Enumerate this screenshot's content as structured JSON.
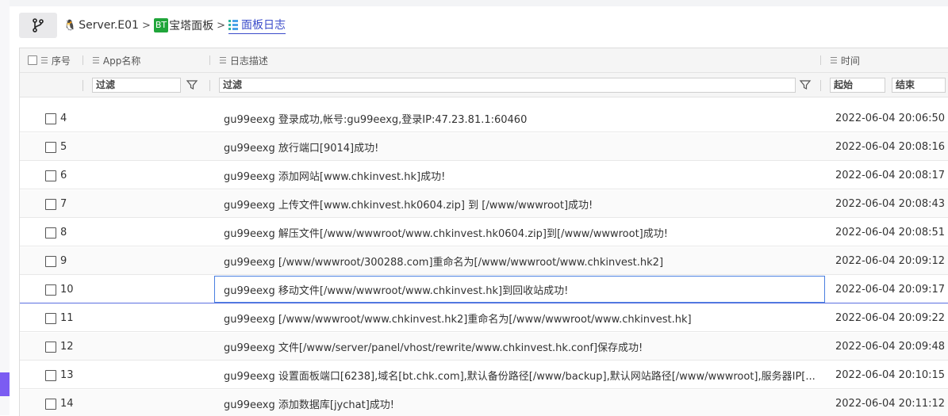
{
  "breadcrumb": {
    "items": [
      {
        "icon": "linux-icon",
        "label": "Server.E01"
      },
      {
        "icon": "bt-logo-icon",
        "badge": "BT",
        "label": "宝塔面板"
      },
      {
        "icon": "log-list-icon",
        "label": "面板日志"
      }
    ],
    "separator": ">"
  },
  "table": {
    "headers": {
      "seq": "序号",
      "app": "App名称",
      "desc": "日志描述",
      "time": "时间"
    },
    "filters": {
      "app": "过滤",
      "desc": "过滤",
      "time_start": "起始",
      "time_end": "结束"
    },
    "rows": [
      {
        "seq": "4",
        "desc": "gu99eexg 登录成功,帐号:gu99eexg,登录IP:47.23.81.1:60460",
        "time": "2022-06-04 20:06:50"
      },
      {
        "seq": "5",
        "desc": "gu99eexg 放行端口[9014]成功!",
        "time": "2022-06-04 20:08:16"
      },
      {
        "seq": "6",
        "desc": "gu99eexg 添加网站[www.chkinvest.hk]成功!",
        "time": "2022-06-04 20:08:17"
      },
      {
        "seq": "7",
        "desc": "gu99eexg 上传文件[www.chkinvest.hk0604.zip] 到 [/www/wwwroot]成功!",
        "time": "2022-06-04 20:08:43"
      },
      {
        "seq": "8",
        "desc": "gu99eexg 解压文件[/www/wwwroot/www.chkinvest.hk0604.zip]到[/www/wwwroot]成功!",
        "time": "2022-06-04 20:08:51"
      },
      {
        "seq": "9",
        "desc": "gu99eexg [/www/wwwroot/300288.com]重命名为[/www/wwwroot/www.chkinvest.hk2]",
        "time": "2022-06-04 20:09:12"
      },
      {
        "seq": "10",
        "desc": "gu99eexg 移动文件[/www/wwwroot/www.chkinvest.hk]到回收站成功!",
        "time": "2022-06-04 20:09:17"
      },
      {
        "seq": "11",
        "desc": "gu99eexg [/www/wwwroot/www.chkinvest.hk2]重命名为[/www/wwwroot/www.chkinvest.hk]",
        "time": "2022-06-04 20:09:22"
      },
      {
        "seq": "12",
        "desc": "gu99eexg 文件[/www/server/panel/vhost/rewrite/www.chkinvest.hk.conf]保存成功!",
        "time": "2022-06-04 20:09:48"
      },
      {
        "seq": "13",
        "desc": "gu99eexg 设置面板端口[6238],域名[bt.chk.com],默认备份路径[/www/backup],默认网站路径[/www/wwwroot],服务器IP[...",
        "time": "2022-06-04 20:10:15"
      },
      {
        "seq": "14",
        "desc": "gu99eexg 添加数据库[jychat]成功!",
        "time": "2022-06-04 20:11:12"
      }
    ]
  },
  "colors": {
    "accent": "#3b4cca",
    "bt_green": "#20a53a",
    "side_tab": "#7b5cf2",
    "focus_border": "#4a7fe0"
  }
}
